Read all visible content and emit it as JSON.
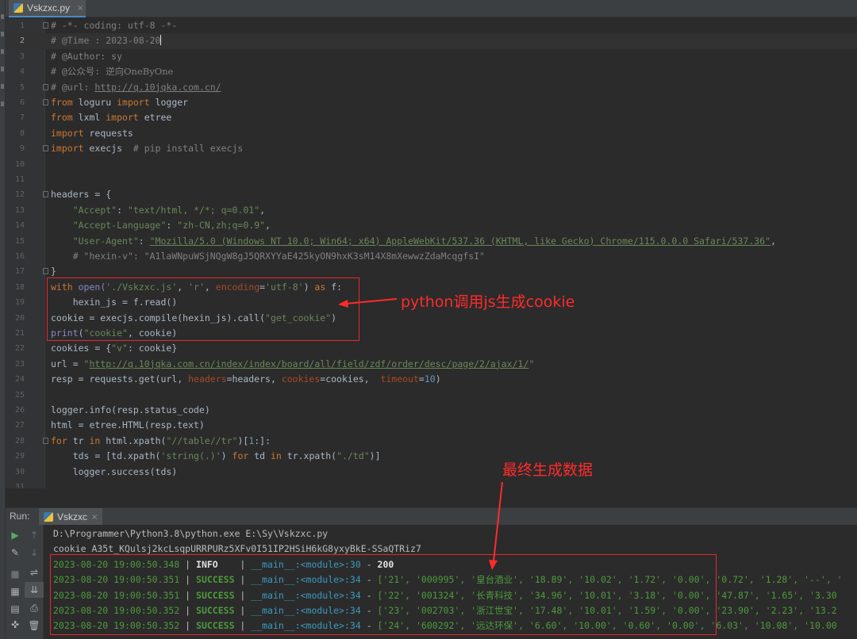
{
  "tab": {
    "label": "Vskzxc.py",
    "close": "×"
  },
  "editor": {
    "line_numbers": [
      "1",
      "2",
      "3",
      "4",
      "5",
      "6",
      "7",
      "8",
      "9",
      "10",
      "11",
      "12",
      "13",
      "14",
      "15",
      "16",
      "17",
      "18",
      "19",
      "20",
      "21",
      "22",
      "23",
      "24",
      "25",
      "26",
      "27",
      "28",
      "29",
      "30",
      "31"
    ],
    "header": {
      "l1": "# -*- coding: utf-8 -*-",
      "l2": "# @Time : 2023-08-20",
      "l3": "# @Author: sy",
      "l4_prefix": "# @公众号: ",
      "l4_name": "逆向OneByOne",
      "l5_prefix": "# @url: ",
      "l5_url": "http://q.10jqka.com.cn/"
    },
    "imports": {
      "from": "from",
      "import": "import",
      "loguru": " loguru ",
      "logger": " logger",
      "lxml": " lxml ",
      "etree": " etree",
      "requests": " requests",
      "execjs": " execjs  ",
      "pip_comment": "# pip install execjs"
    },
    "headers": {
      "open": "headers = {",
      "k_accept": "\"Accept\"",
      "v_accept": "\"text/html, */*; q=0.01\"",
      "k_lang": "\"Accept-Language\"",
      "v_lang": "\"zh-CN,zh;q=0.9\"",
      "k_ua": "\"User-Agent\"",
      "v_ua": "\"Mozilla/5.0 (Windows NT 10.0; Win64; x64) AppleWebKit/537.36 (KHTML, like Gecko) Chrome/115.0.0.0 Safari/537.36\"",
      "hexin_comment": "# \"hexin-v\": \"A1laWNpuWSjNQgW8gJ5QRXYYaE425kyON9hxK3sM14X8mXewwzZdaMcqgfsI\"",
      "close": "}"
    },
    "js": {
      "with": "with",
      "open_fn": " open(",
      "js_file": "'./Vskzxc.js'",
      "mode": "'r'",
      "enc_param": "encoding",
      "enc_val": "'utf-8'",
      "as": "as",
      "f": " f:",
      "read": "hexin_js = f.read()",
      "compile_a": "cookie = execjs.compile(hexin_js).call(",
      "compile_fn": "\"get_cookie\"",
      "print_fn": "print",
      "print_str": "\"cookie\"",
      "print_rest": ", cookie)"
    },
    "request": {
      "cookies_a": "cookies = {",
      "cookies_key": "\"v\"",
      "cookies_b": ": cookie}",
      "url_a": "url = ",
      "url_val": "http://q.10jqka.com.cn/index/index/board/all/field/zdf/order/desc/page/2/ajax/1/",
      "resp_a": "resp = requests.get(url, ",
      "p_headers": "headers",
      "p_headers_v": "=headers, ",
      "p_cookies": "cookies",
      "p_cookies_v": "=cookies,  ",
      "p_timeout": "timeout",
      "p_timeout_eq": "=",
      "p_timeout_v": "10",
      "resp_close": ")"
    },
    "parse": {
      "l26": "logger.info(resp.status_code)",
      "l27": "html = etree.HTML(resp.text)",
      "for": "for",
      "tr": " tr ",
      "in": "in",
      "xpath_a": " html.xpath(",
      "xpath_str": "\"//table//tr\"",
      "xpath_b": ")[",
      "xpath_idx": "1",
      "xpath_c": ":]:",
      "tds_a": "tds = [td.xpath(",
      "tds_str": "'string(.)'",
      "tds_b": ") ",
      "tds_for": "for",
      "tds_td": " td ",
      "tds_in": "in",
      "tds_c": " tr.xpath(",
      "tds_str2": "\"./td\"",
      "tds_d": ")]",
      "l30": "logger.success(tds)"
    }
  },
  "annotations": {
    "box1_label": "python调用js生成cookie",
    "box2_label": "最终生成数据"
  },
  "run": {
    "label": "Run:",
    "tab_label": "Vskzxc",
    "close": "×",
    "lines": {
      "cmd": "D:\\Programmer\\Python3.8\\python.exe E:\\Sy\\Vskzxc.py",
      "cookie": "cookie A35t_KQulsj2kcLsqpURRPURz5XFv0I51IP2HSiH6kG8yxyBkE-SSaQTRiz7"
    },
    "log": [
      {
        "time": "2023-08-20 19:00:50.348",
        "level": "INFO   ",
        "module": "__main__:<module>:30",
        "msg_a": "200",
        "msg_b": "",
        "cn": "",
        "msg_c": ""
      },
      {
        "time": "2023-08-20 19:00:50.351",
        "level": "SUCCESS",
        "module": "__main__:<module>:34",
        "msg_a": "['21', '000995', '",
        "cn": "皇台酒业",
        "msg_c": "', '18.89', '10.02', '1.72', '0.00', '0.72', '1.28', '--', '"
      },
      {
        "time": "2023-08-20 19:00:50.351",
        "level": "SUCCESS",
        "module": "__main__:<module>:34",
        "msg_a": "['22', '001324', '",
        "cn": "长青科技",
        "msg_c": "', '34.96', '10.01', '3.18', '0.00', '47.87', '1.65', '3.30"
      },
      {
        "time": "2023-08-20 19:00:50.352",
        "level": "SUCCESS",
        "module": "__main__:<module>:34",
        "msg_a": "['23', '002703', '",
        "cn": "浙江世宝",
        "msg_c": "', '17.48', '10.01', '1.59', '0.00', '23.90', '2.23', '13.2"
      },
      {
        "time": "2023-08-20 19:00:50.352",
        "level": "SUCCESS",
        "module": "__main__:<module>:34",
        "msg_a": "['24', '600292', '",
        "cn": "远达环保",
        "msg_c": "', '6.60', '10.00', '0.60', '0.00', '6.03', '10.08', '10.00"
      }
    ],
    "sep": " | ",
    "dash": " - "
  }
}
